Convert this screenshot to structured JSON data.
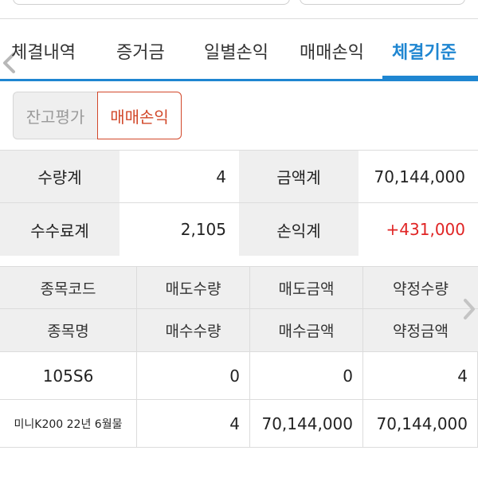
{
  "tabs": [
    {
      "label": "체결내역"
    },
    {
      "label": "증거금"
    },
    {
      "label": "일별손익"
    },
    {
      "label": "매매손익"
    },
    {
      "label": "체결기준"
    }
  ],
  "segment": {
    "off_label": "잔고평가",
    "on_label": "매매손익"
  },
  "summary": {
    "qty_label": "수량계",
    "qty_value": "4",
    "amount_label": "금액계",
    "amount_value": "70,144,000",
    "fee_label": "수수료계",
    "fee_value": "2,105",
    "pnl_label": "손익계",
    "pnl_value": "+431,000"
  },
  "table": {
    "header1": [
      "종목코드",
      "매도수량",
      "매도금액",
      "약정수량"
    ],
    "header2": [
      "종목명",
      "매수수량",
      "매수금액",
      "약정금액"
    ],
    "rows": [
      [
        "105S6",
        "0",
        "0",
        "4"
      ],
      [
        "미니K200 22년 6월물",
        "4",
        "70,144,000",
        "70,144,000"
      ]
    ]
  },
  "colors": {
    "accent": "#1f86d1",
    "segment_active": "#d2482a",
    "profit": "#e02424"
  },
  "icons": [
    "chevron-left-icon",
    "chevron-right-icon"
  ]
}
